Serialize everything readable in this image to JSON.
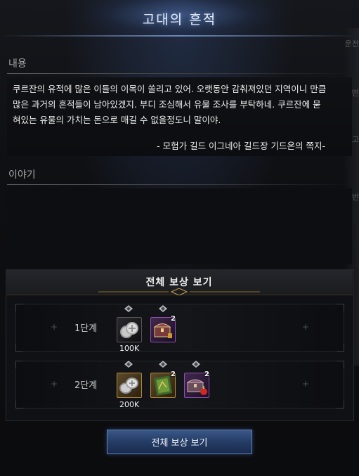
{
  "header": {
    "title": "고대의 흔적"
  },
  "sections": {
    "content_label": "내용",
    "content_text": "쿠르잔의 유적에 많은 이들의 이목이 쏠리고 있어. 오랫동안 감춰져있던 지역이니 만큼 많은 과거의 흔적들이 남아있겠지. 부디 조심해서 유물 조사를 부탁하네. 쿠르잔에 묻혀있는 유물의 가치는 돈으로 매길 수 없을정도니 말이야.",
    "content_sign": "- 모험가 길드 이그네아 길드장 기드온의 쪽지-",
    "story_label": "이야기"
  },
  "side_fragments": [
    "운전",
    "어떤",
    "아고",
    "이번"
  ],
  "rewards": {
    "panel_title": "전체 보상 보기",
    "tiers": [
      {
        "label": "1단계",
        "items": [
          {
            "icon": "silver-coin-icon",
            "grade": "common",
            "quantity": "100K",
            "badge": ""
          },
          {
            "icon": "treasure-chest-icon",
            "grade": "epic",
            "quantity": "",
            "badge": "2"
          }
        ]
      },
      {
        "label": "2단계",
        "items": [
          {
            "icon": "silver-coin-icon",
            "grade": "rare",
            "quantity": "200K",
            "badge": ""
          },
          {
            "icon": "map-scroll-icon",
            "grade": "rare",
            "quantity": "",
            "badge": "2"
          },
          {
            "icon": "treasure-chest-with-potion-icon",
            "grade": "epic",
            "quantity": "",
            "badge": "2"
          }
        ]
      }
    ]
  },
  "footer": {
    "view_all_button": "전체 보상 보기"
  },
  "colors": {
    "accent": "#3a5788",
    "gold_line": "#b08a3a",
    "epic": "#8a4fae"
  }
}
